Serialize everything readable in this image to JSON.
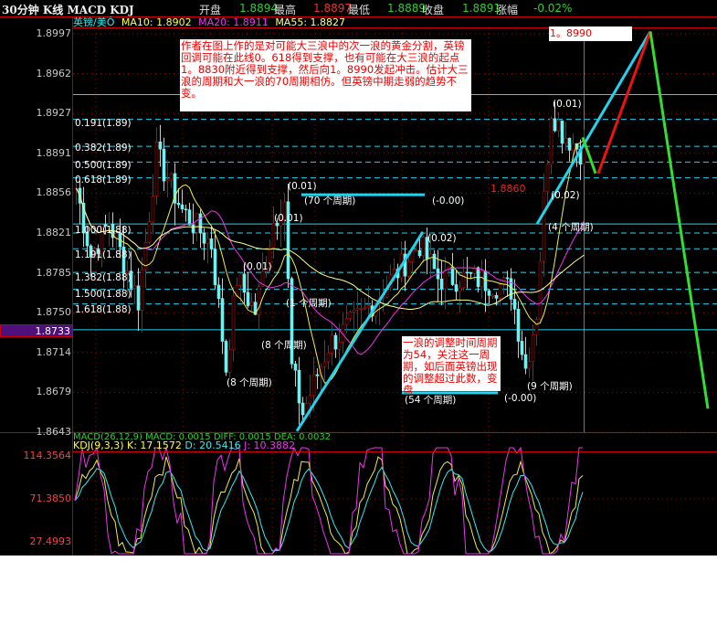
{
  "header": {
    "title": "30分钟 K线 MACD KDJ",
    "open_label": "开盘",
    "open": "1.8894",
    "high_label": "最高",
    "high": "1.8897",
    "low_label": "最低",
    "low": "1.8889",
    "close_label": "收盘",
    "close": "1.8891",
    "change_label": "涨幅",
    "change": "-0.02%"
  },
  "ma_bar": {
    "symbol": "英镑/美Ô",
    "ma10": "MA10: 1.8902",
    "ma20": "MA20: 1.8911",
    "ma55": "MA55: 1.8827"
  },
  "price_axis": [
    "1.8997",
    "1.8962",
    "1.8927",
    "1.8891",
    "1.8856",
    "1.8821",
    "1.8785",
    "1.8750",
    "1.8714",
    "1.8679",
    "1.8643"
  ],
  "current_price": "1.8733",
  "macd_bar": "MACD(26,12,9) MACD: 0.0015 DIFF: 0.0015 DEA: 0.0032",
  "kdj_bar": {
    "name": "KDJ(9,3,3)",
    "k": "K: 17.1572",
    "d": "D: 20.5416",
    "j": "J: 10.3882"
  },
  "kdj_axis": [
    "114.3564",
    "71.3850",
    "27.4993"
  ],
  "notes": {
    "main": "作者在图上作的是对可能大三浪中的次一浪的黄金分割，英镑回调可能在此线0。618得到支撑，也有可能在大三浪的起点1。8830附近得到支撑，然后向1。8990发起冲击。估计大三浪的周期和大一浪的70周期相仿。但英镑中期走弱的趋势不变。",
    "cycle": "一浪的调整时间周期为54，关注这一周期，如后面英镑出现的调整超过此数，变盘",
    "target": "1。8990",
    "level": "1.8860"
  },
  "fib_labels": [
    "0.191(1.89)",
    "0.382(1.89)",
    "0.500(1.89)",
    "0.618(1.89)",
    "1.000(1.88)",
    "1.191(1.88)",
    "1.382(1.88)",
    "1.500(1.88)",
    "1.618(1.88)"
  ],
  "wave_labels": [
    "(0.01)",
    "(70 个周期)",
    "(-0.00)",
    "(0.01)",
    "(0.01)",
    "(1 个周期)",
    "(8 个周期)",
    "(8 个周期)",
    "(0.02)",
    "(54 个周期)",
    "(-0.00)",
    "(9 个周期)",
    "(0.01)",
    "(0.02)",
    "(4 个周期)"
  ],
  "chart_data": {
    "type": "candlestick",
    "title": "30分钟 K线 英镑/美元",
    "ylim": [
      1.8643,
      1.8997
    ],
    "price_path": [
      [
        0,
        1.886
      ],
      [
        4,
        1.88
      ],
      [
        9,
        1.883
      ],
      [
        17,
        1.876
      ],
      [
        22,
        1.889
      ],
      [
        29,
        1.884
      ],
      [
        37,
        1.881
      ],
      [
        41,
        1.87
      ],
      [
        44,
        1.878
      ],
      [
        49,
        1.875
      ],
      [
        54,
        1.883
      ],
      [
        57,
        1.885
      ],
      [
        59,
        1.87
      ],
      [
        62,
        1.866
      ],
      [
        69,
        1.872
      ],
      [
        79,
        1.875
      ],
      [
        89,
        1.879
      ],
      [
        94,
        1.881
      ],
      [
        99,
        1.878
      ],
      [
        109,
        1.878
      ],
      [
        119,
        1.877
      ],
      [
        123,
        1.87
      ],
      [
        126,
        1.875
      ],
      [
        128,
        1.885
      ],
      [
        130,
        1.893
      ],
      [
        133,
        1.891
      ],
      [
        139,
        1.889
      ]
    ],
    "hlines": [
      {
        "price": 1.8943,
        "style": "solid"
      },
      {
        "price": 1.8828,
        "style": "solid"
      },
      {
        "price": 1.8734,
        "style": "solid"
      }
    ],
    "fib_levels": [
      1.8921,
      1.8897,
      1.8883,
      1.8869,
      1.882,
      1.8806,
      1.8785,
      1.877,
      1.8757
    ],
    "trendlines": [
      {
        "color": "#22d3ee",
        "from": [
          60.75,
          1.8644
        ],
        "to": [
          95.25,
          1.8821
        ]
      },
      {
        "color": "#22d3ee",
        "from": [
          126.5,
          1.8828
        ],
        "to": [
          157.5,
          1.8999
        ]
      },
      {
        "color": "#ee1111",
        "from": [
          143.25,
          1.8873
        ],
        "to": [
          157.5,
          1.8999
        ]
      },
      {
        "color": "#33dd33",
        "from": [
          139,
          1.8905
        ],
        "to": [
          142.5,
          1.8873
        ]
      },
      {
        "color": "#33dd33",
        "from": [
          157.5,
          1.8999
        ],
        "to": [
          173.25,
          1.8664
        ]
      },
      {
        "color": "#22d3ee",
        "from": [
          62,
          1.8854
        ],
        "to": [
          95.75,
          1.8854
        ]
      },
      {
        "color": "#22d3ee",
        "from": [
          89.5,
          1.8678
        ],
        "to": [
          115.75,
          1.8678
        ]
      }
    ],
    "kdj_range": [
      0,
      120
    ]
  }
}
